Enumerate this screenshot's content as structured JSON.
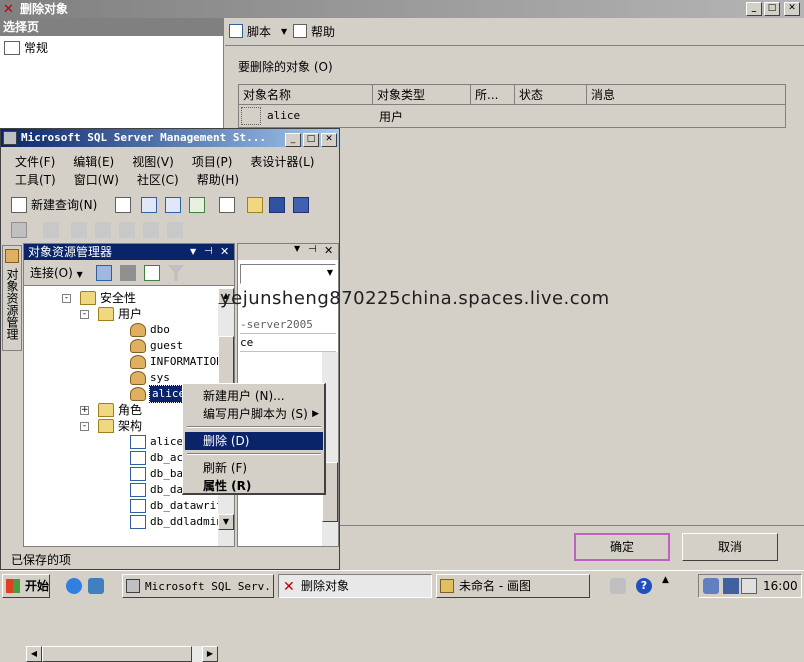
{
  "dialog": {
    "title": "删除对象",
    "left_header": "选择页",
    "left_item": "常规",
    "toolbar": {
      "script": "脚本",
      "help": "帮助"
    },
    "objects_label": "要删除的对象 (O)",
    "columns": [
      "对象名称",
      "对象类型",
      "所...",
      "状态",
      "消息"
    ],
    "row": {
      "name": "alice",
      "type": "用户"
    },
    "ok": "确定",
    "cancel": "取消"
  },
  "ssms": {
    "title": "Microsoft SQL Server Management St...",
    "menu_row1": [
      "文件(F)",
      "编辑(E)",
      "视图(V)",
      "项目(P)",
      "表设计器(L)"
    ],
    "menu_row2": [
      "工具(T)",
      "窗口(W)",
      "社区(C)",
      "帮助(H)"
    ],
    "new_query": "新建查询(N)",
    "vertical_tab": "对象资源管理器",
    "oe_title": "对象资源管理器",
    "connect": "连接(O)",
    "tree": [
      {
        "label": "安全性",
        "indent": 1,
        "icon": "folder",
        "expander": "-"
      },
      {
        "label": "用户",
        "indent": 2,
        "icon": "folder",
        "expander": "-"
      },
      {
        "label": "dbo",
        "indent": 3,
        "icon": "user"
      },
      {
        "label": "guest",
        "indent": 3,
        "icon": "user"
      },
      {
        "label": "INFORMATION",
        "indent": 3,
        "icon": "user"
      },
      {
        "label": "sys",
        "indent": 3,
        "icon": "user"
      },
      {
        "label": "alice",
        "indent": 3,
        "icon": "user",
        "selected": true
      },
      {
        "label": "角色",
        "indent": 2,
        "icon": "folder",
        "expander": "+"
      },
      {
        "label": "架构",
        "indent": 2,
        "icon": "folder",
        "expander": "-"
      },
      {
        "label": "alice",
        "indent": 3,
        "icon": "schema"
      },
      {
        "label": "db_acc",
        "indent": 3,
        "icon": "schema"
      },
      {
        "label": "db_bac",
        "indent": 3,
        "icon": "schema"
      },
      {
        "label": "db_dat",
        "indent": 3,
        "icon": "schema"
      },
      {
        "label": "db_datawrit",
        "indent": 3,
        "icon": "schema"
      },
      {
        "label": "db_ddladmin",
        "indent": 3,
        "icon": "schema"
      }
    ],
    "props": {
      "server": "-server2005",
      "value": "ce"
    },
    "status": "已保存的项"
  },
  "context_menu": {
    "items": [
      "新建用户 (N)...",
      "编写用户脚本为 (S)",
      "删除 (D)",
      "刷新 (F)",
      "属性 (R)"
    ]
  },
  "watermark": "yejunsheng870225china.spaces.live.com",
  "taskbar": {
    "start": "开始",
    "tasks": [
      "Microsoft SQL Serv...",
      "删除对象",
      "未命名 - 画图"
    ],
    "clock": "16:00"
  }
}
